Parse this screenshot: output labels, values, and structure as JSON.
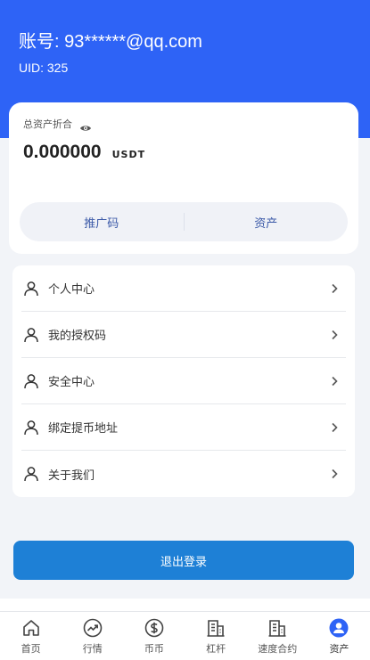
{
  "header": {
    "account": "账号: 93******@qq.com",
    "uid": "UID: 325"
  },
  "asset": {
    "label": "总资产折合",
    "value": "0.000000",
    "unit": "USDT",
    "eye_icon": "eye-icon",
    "tabs": [
      "推广码",
      "资产"
    ]
  },
  "menu": [
    {
      "label": "个人中心",
      "icon": "user-icon"
    },
    {
      "label": "我的授权码",
      "icon": "user-icon"
    },
    {
      "label": "安全中心",
      "icon": "user-icon"
    },
    {
      "label": "绑定提币地址",
      "icon": "user-icon"
    },
    {
      "label": "关于我们",
      "icon": "user-icon"
    }
  ],
  "logout_label": "退出登录",
  "tabbar": [
    {
      "label": "首页",
      "icon": "home-icon"
    },
    {
      "label": "行情",
      "icon": "trend-icon"
    },
    {
      "label": "币币",
      "icon": "dollar-icon"
    },
    {
      "label": "杠杆",
      "icon": "building-icon"
    },
    {
      "label": "速度合约",
      "icon": "building-icon"
    },
    {
      "label": "资产",
      "icon": "profile-icon",
      "active": true
    }
  ],
  "colors": {
    "header_bg": "#2e63f6",
    "logout_bg": "#1e80d6",
    "active_icon": "#2e63f6",
    "tab_text": "#3c5aa8"
  }
}
